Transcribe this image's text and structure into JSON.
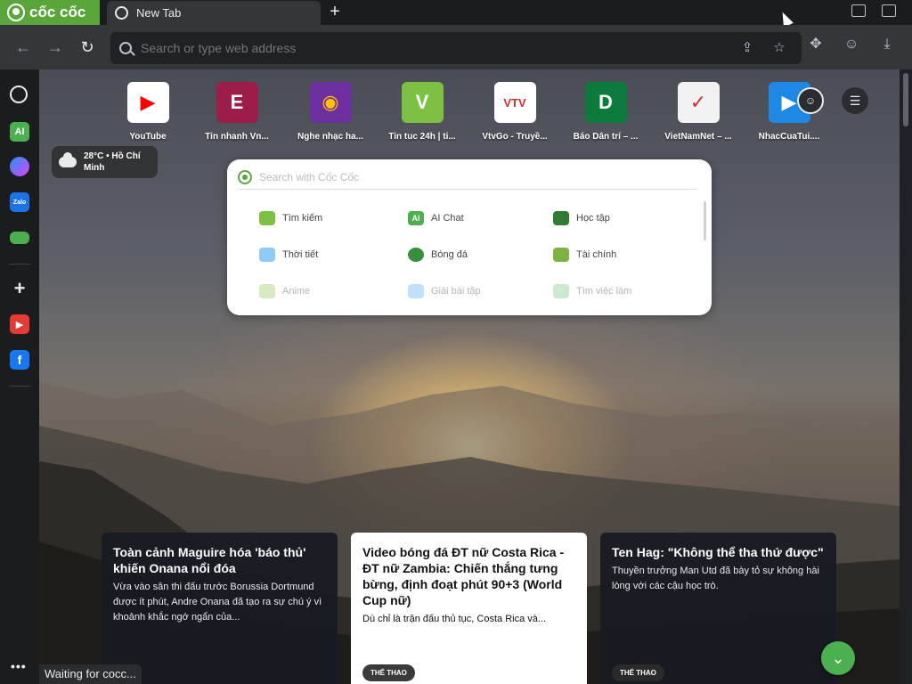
{
  "browser": {
    "brand": "cốc cốc",
    "tab_title": "New Tab",
    "new_tab_symbol": "+",
    "address_placeholder": "Search or type web address",
    "status_text": "Waiting for cocc...",
    "icons": {
      "back": "arrow-left-icon",
      "forward": "arrow-right-icon",
      "reload": "reload-icon",
      "share": "share-icon",
      "bookmark": "star-icon",
      "extensions": "puzzle-icon",
      "profile": "profile-icon",
      "downloads": "download-icon"
    }
  },
  "sidebar": {
    "items": [
      {
        "name": "history",
        "glyph": "↻",
        "color": "#1b1c1e"
      },
      {
        "name": "ai",
        "glyph": "AI",
        "color": "#4caf50"
      },
      {
        "name": "messenger",
        "glyph": "✉",
        "color": "#7b5cff"
      },
      {
        "name": "zalo",
        "glyph": "Zalo",
        "color": "#1a73e8"
      },
      {
        "name": "games",
        "glyph": "🎮",
        "color": "#1b1c1e"
      },
      {
        "name": "add",
        "glyph": "+",
        "color": "#1b1c1e"
      },
      {
        "name": "youtube",
        "glyph": "▶",
        "color": "#e53935"
      },
      {
        "name": "facebook",
        "glyph": "f",
        "color": "#1877f2"
      }
    ],
    "more": "•••"
  },
  "shortcuts": [
    {
      "label": "YouTube",
      "glyph": "▶",
      "bg": "#ffffff",
      "fg": "#ff0000"
    },
    {
      "label": "Tin nhanh Vn...",
      "glyph": "E",
      "bg": "#9c1c4a",
      "fg": "#ffffff"
    },
    {
      "label": "Nghe nhạc ha...",
      "glyph": "◉",
      "bg": "#6b2fa0",
      "fg": "#ffc107"
    },
    {
      "label": "Tin tuc 24h | ti...",
      "glyph": "V",
      "bg": "#7cc143",
      "fg": "#ffffff"
    },
    {
      "label": "VtvGo - Truyề...",
      "glyph": "VTV",
      "bg": "#ffffff",
      "fg": "#d32f2f"
    },
    {
      "label": "Báo Dân trí – ...",
      "glyph": "D",
      "bg": "#0b7a3b",
      "fg": "#ffffff"
    },
    {
      "label": "VietNamNet – ...",
      "glyph": "✓",
      "bg": "#f2f2f2",
      "fg": "#d32f2f"
    },
    {
      "label": "NhacCuaTui....",
      "glyph": "▶",
      "bg": "#1e88e5",
      "fg": "#ffffff"
    }
  ],
  "weather": {
    "line1": "28°C • Hồ Chí",
    "line2": "Minh"
  },
  "search": {
    "placeholder": "Search with Cốc Cốc",
    "categories": [
      {
        "label": "Tìm kiếm",
        "glyph": "◎",
        "color": "#7cc143"
      },
      {
        "label": "AI Chat",
        "glyph": "AI",
        "color": "#4caf50"
      },
      {
        "label": "Học tập",
        "glyph": "▲",
        "color": "#2e7d32"
      },
      {
        "label": "Thời tiết",
        "glyph": "☁",
        "color": "#90caf9"
      },
      {
        "label": "Bóng đá",
        "glyph": "●",
        "color": "#388e3c"
      },
      {
        "label": "Tài chính",
        "glyph": "$",
        "color": "#7cb342"
      },
      {
        "label": "Anime",
        "glyph": "▤",
        "color": "#9ccc65"
      },
      {
        "label": "Giải bài tập",
        "glyph": "▦",
        "color": "#64b5f6"
      },
      {
        "label": "Tìm việc làm",
        "glyph": "▣",
        "color": "#81c784"
      }
    ]
  },
  "news": [
    {
      "title": "Toàn cảnh Maguire hóa 'báo thủ' khiến Onana nổi đóa",
      "summary": "Vừa vào sân thi đấu trước Borussia Dortmund được ít phút, Andre Onana đã tạo ra sự chú ý vì khoảnh khắc ngớ ngẩn của...",
      "tag": ""
    },
    {
      "title": "Video bóng đá ĐT nữ Costa Rica - ĐT nữ Zambia: Chiến thắng tưng bừng, định đoạt phút 90+3 (World Cup nữ)",
      "summary": "Dù chỉ là trận đấu thủ tục, Costa Rica và...",
      "tag": "THỂ THAO"
    },
    {
      "title": "Ten Hag: \"Không thể tha thứ được\"",
      "summary": "Thuyền trưởng Man Utd đã bày tỏ sự không hài lòng với các cậu học trò.",
      "tag": "THỂ THAO"
    }
  ]
}
